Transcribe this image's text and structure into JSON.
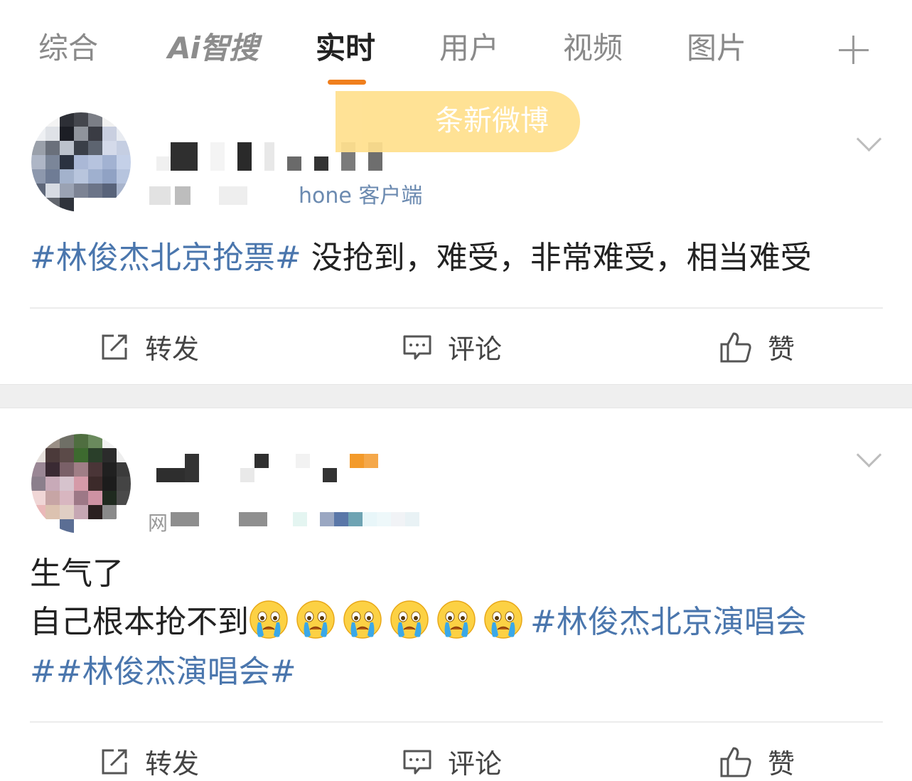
{
  "tabs": [
    {
      "label": "综合",
      "active": false
    },
    {
      "label": "Ai智搜",
      "active": false
    },
    {
      "label": "实时",
      "active": true
    },
    {
      "label": "用户",
      "active": false
    },
    {
      "label": "视频",
      "active": false
    },
    {
      "label": "图片",
      "active": false
    }
  ],
  "toast": {
    "text": "条新微博"
  },
  "posts": [
    {
      "meta_visible": "hone 客户端",
      "content": {
        "topic": "#林俊杰北京抢票#",
        "text": " 没抢到，难受，非常难受，相当难受"
      },
      "actions": {
        "repost": "转发",
        "comment": "评论",
        "like": "赞"
      }
    },
    {
      "meta_visible": "网",
      "content": {
        "line1": "生气了",
        "line2_text": "自己根本抢不到",
        "emoji_name": "crying-face",
        "emoji_count": 6,
        "line2_topic": "#林俊杰北京演唱会",
        "line3_topic": "##林俊杰演唱会#"
      },
      "actions": {
        "repost": "转发",
        "comment": "评论",
        "like": "赞"
      }
    }
  ],
  "colors": {
    "accent_underline": "#f07f1d",
    "topic_link": "#4a76ad",
    "toast_bg": "#ffe08e",
    "source_text": "#6b8ab0"
  }
}
